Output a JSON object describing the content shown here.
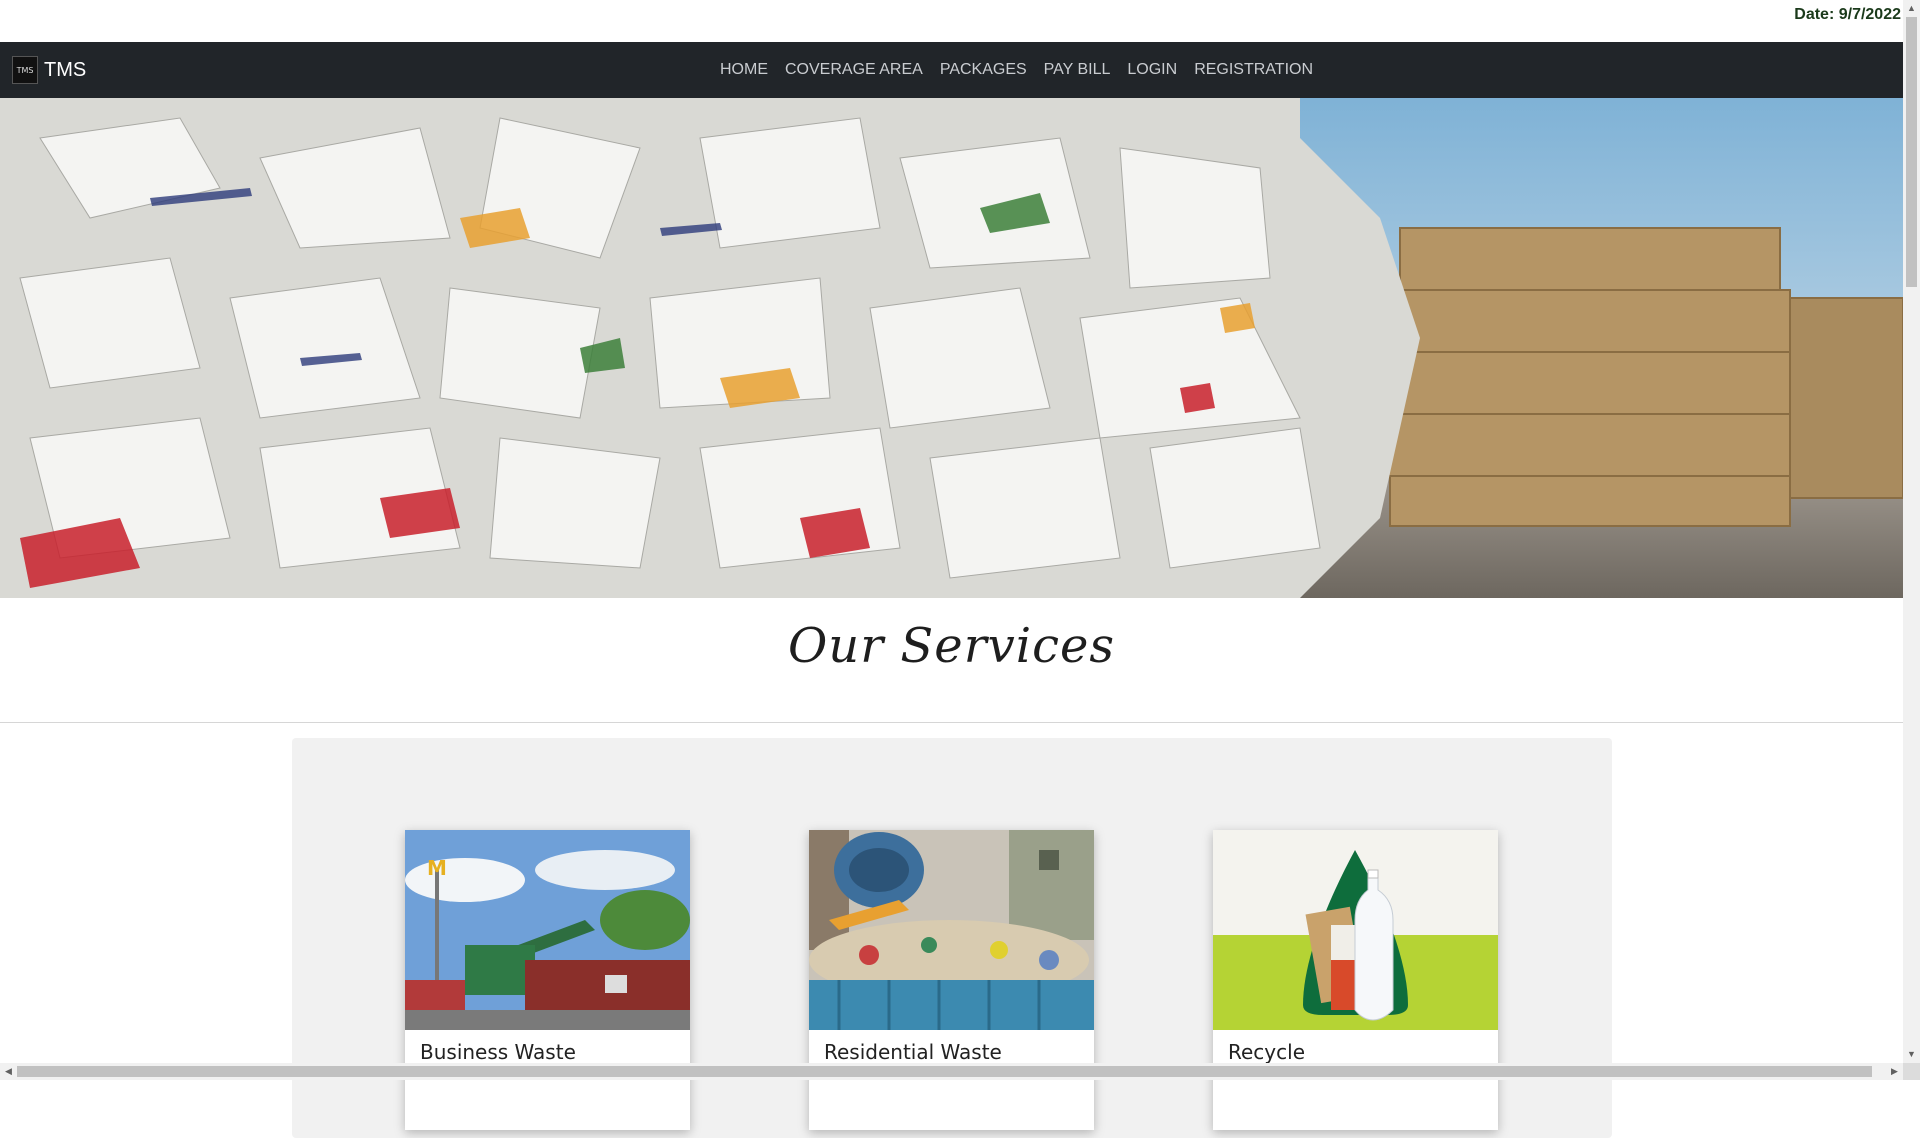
{
  "date_label": "Date: 9/7/2022",
  "brand": {
    "logo_text": "TMS",
    "name": "TMS"
  },
  "nav": {
    "items": [
      {
        "label": "HOME"
      },
      {
        "label": "COVERAGE AREA"
      },
      {
        "label": "PACKAGES"
      },
      {
        "label": "PAY BILL"
      },
      {
        "label": "LOGIN"
      },
      {
        "label": "REGISTRATION"
      }
    ]
  },
  "services": {
    "title": "Our Services",
    "cards": [
      {
        "title": "Business Waste"
      },
      {
        "title": "Residential Waste"
      },
      {
        "title": "Recycle"
      }
    ]
  },
  "colors": {
    "navbar": "#212529",
    "panel": "#f1f1f1",
    "recycle_green": "#b5d334"
  }
}
